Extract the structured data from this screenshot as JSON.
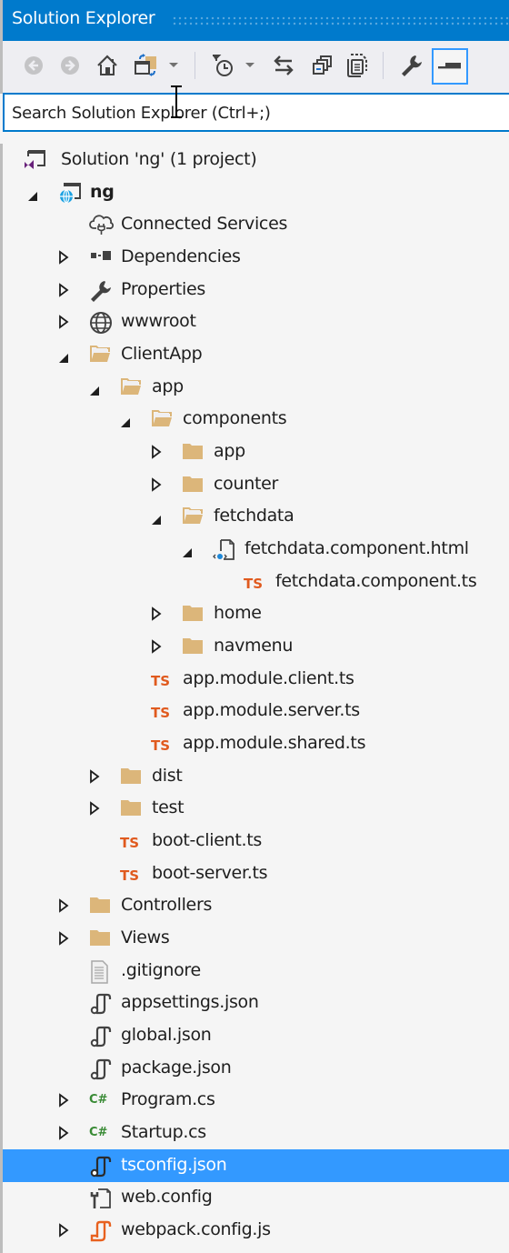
{
  "window": {
    "title": "Solution Explorer",
    "title_bar_color": "#007ACC",
    "selection_color": "#3399FF"
  },
  "toolbar": {
    "buttons": [
      {
        "name": "back",
        "icon": "back-arrow-icon",
        "enabled": false
      },
      {
        "name": "forward",
        "icon": "forward-arrow-icon",
        "enabled": false
      },
      {
        "name": "home",
        "icon": "home-icon",
        "enabled": true
      },
      {
        "name": "switch-views",
        "icon": "switch-views-icon",
        "enabled": true
      },
      {
        "name": "switch-views-dropdown",
        "icon": "chevron-down-icon",
        "enabled": true
      },
      {
        "name": "pending-changes-filter",
        "icon": "pending-changes-filter-icon",
        "enabled": true
      },
      {
        "name": "pending-changes-filter-dropdown",
        "icon": "chevron-down-icon",
        "enabled": true
      },
      {
        "name": "sync-with-active-document",
        "icon": "sync-arrows-icon",
        "enabled": true
      },
      {
        "name": "collapse-all",
        "icon": "collapse-all-icon",
        "enabled": true
      },
      {
        "name": "show-all-files",
        "icon": "show-all-files-icon",
        "enabled": true
      },
      {
        "name": "properties",
        "icon": "wrench-icon",
        "enabled": true
      },
      {
        "name": "preview-selected-items",
        "icon": "preview-icon",
        "enabled": true,
        "active": true
      }
    ]
  },
  "search": {
    "placeholder": "Search Solution Explorer (Ctrl+;)",
    "value": ""
  },
  "tree": [
    {
      "label": "Solution 'ng' (1 project)",
      "level": 0,
      "expander": "none",
      "icon": "solution-icon"
    },
    {
      "label": "ng",
      "level": 1,
      "expander": "expanded",
      "icon": "web-project-icon",
      "bold": true
    },
    {
      "label": "Connected Services",
      "level": 2,
      "expander": "none",
      "icon": "connected-services-icon"
    },
    {
      "label": "Dependencies",
      "level": 2,
      "expander": "collapsed",
      "icon": "dependencies-icon"
    },
    {
      "label": "Properties",
      "level": 2,
      "expander": "collapsed",
      "icon": "wrench-icon"
    },
    {
      "label": "wwwroot",
      "level": 2,
      "expander": "collapsed",
      "icon": "globe-icon"
    },
    {
      "label": "ClientApp",
      "level": 2,
      "expander": "expanded",
      "icon": "folder-open-icon"
    },
    {
      "label": "app",
      "level": 3,
      "expander": "expanded",
      "icon": "folder-open-icon"
    },
    {
      "label": "components",
      "level": 4,
      "expander": "expanded",
      "icon": "folder-open-icon"
    },
    {
      "label": "app",
      "level": 5,
      "expander": "collapsed",
      "icon": "folder-icon"
    },
    {
      "label": "counter",
      "level": 5,
      "expander": "collapsed",
      "icon": "folder-icon"
    },
    {
      "label": "fetchdata",
      "level": 5,
      "expander": "expanded",
      "icon": "folder-open-icon"
    },
    {
      "label": "fetchdata.component.html",
      "level": 6,
      "expander": "expanded",
      "icon": "html-file-icon"
    },
    {
      "label": "fetchdata.component.ts",
      "level": 7,
      "expander": "none",
      "icon": "typescript-icon"
    },
    {
      "label": "home",
      "level": 5,
      "expander": "collapsed",
      "icon": "folder-icon"
    },
    {
      "label": "navmenu",
      "level": 5,
      "expander": "collapsed",
      "icon": "folder-icon"
    },
    {
      "label": "app.module.client.ts",
      "level": 4,
      "expander": "none",
      "icon": "typescript-icon"
    },
    {
      "label": "app.module.server.ts",
      "level": 4,
      "expander": "none",
      "icon": "typescript-icon"
    },
    {
      "label": "app.module.shared.ts",
      "level": 4,
      "expander": "none",
      "icon": "typescript-icon"
    },
    {
      "label": "dist",
      "level": 3,
      "expander": "collapsed",
      "icon": "folder-icon"
    },
    {
      "label": "test",
      "level": 3,
      "expander": "collapsed",
      "icon": "folder-icon"
    },
    {
      "label": "boot-client.ts",
      "level": 3,
      "expander": "none",
      "icon": "typescript-icon"
    },
    {
      "label": "boot-server.ts",
      "level": 3,
      "expander": "none",
      "icon": "typescript-icon"
    },
    {
      "label": "Controllers",
      "level": 2,
      "expander": "collapsed",
      "icon": "folder-icon"
    },
    {
      "label": "Views",
      "level": 2,
      "expander": "collapsed",
      "icon": "folder-icon"
    },
    {
      "label": ".gitignore",
      "level": 2,
      "expander": "none",
      "icon": "text-file-icon"
    },
    {
      "label": "appsettings.json",
      "level": 2,
      "expander": "none",
      "icon": "json-file-icon"
    },
    {
      "label": "global.json",
      "level": 2,
      "expander": "none",
      "icon": "json-file-icon"
    },
    {
      "label": "package.json",
      "level": 2,
      "expander": "none",
      "icon": "json-file-icon"
    },
    {
      "label": "Program.cs",
      "level": 2,
      "expander": "collapsed",
      "icon": "csharp-file-icon"
    },
    {
      "label": "Startup.cs",
      "level": 2,
      "expander": "collapsed",
      "icon": "csharp-file-icon"
    },
    {
      "label": "tsconfig.json",
      "level": 2,
      "expander": "none",
      "icon": "json-file-icon",
      "selected": true
    },
    {
      "label": "web.config",
      "level": 2,
      "expander": "none",
      "icon": "config-file-icon"
    },
    {
      "label": "webpack.config.js",
      "level": 2,
      "expander": "collapsed",
      "icon": "js-file-icon"
    }
  ],
  "icon_glyphs": {
    "typescript-icon": "TS",
    "csharp-file-icon": "C#"
  }
}
